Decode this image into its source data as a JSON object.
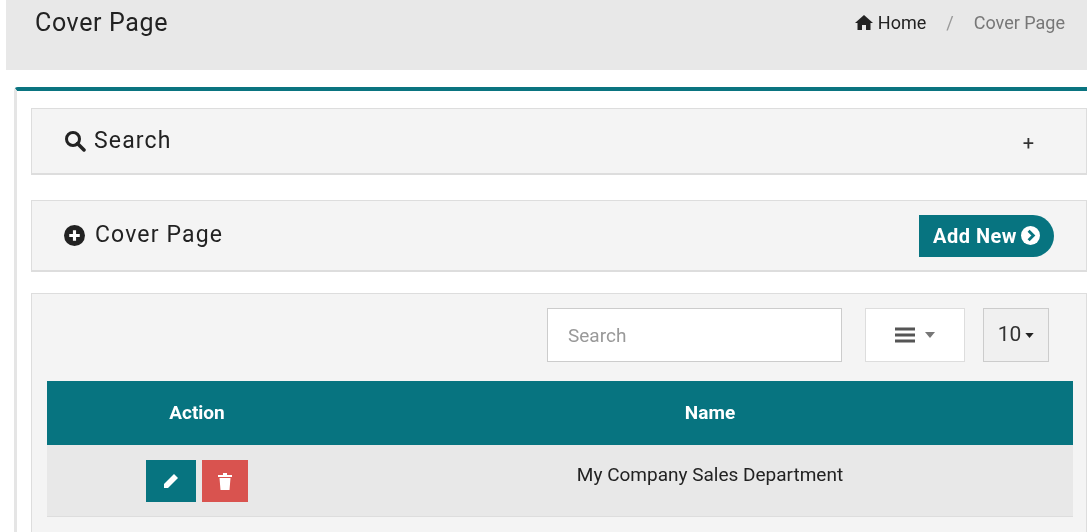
{
  "header": {
    "title": "Cover Page",
    "breadcrumb": [
      {
        "label": "Home",
        "kind": "link"
      },
      {
        "label": "Cover Page",
        "kind": "current"
      }
    ],
    "separator": "/"
  },
  "search_panel": {
    "title": "Search",
    "toggle": "+"
  },
  "cover_panel": {
    "title": "Cover Page",
    "button": "Add New"
  },
  "table_toolbar": {
    "search_placeholder": "Search",
    "page_size": "10"
  },
  "table": {
    "columns": [
      "Action",
      "Name"
    ],
    "rows": [
      {
        "name": "My Company Sales Department"
      }
    ]
  }
}
